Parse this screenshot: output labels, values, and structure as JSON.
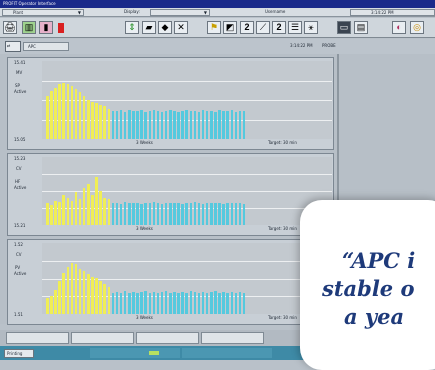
{
  "window": {
    "title": "PROFIT Operator Interface"
  },
  "menubar": {
    "plant_label": "Plant",
    "display_label": "Display:",
    "username_label": "Username",
    "time": "3:14:22 PM"
  },
  "subheader": {
    "section": "APC",
    "timestamp": "3:14:22 PM",
    "mode": "PROBE"
  },
  "panels": [
    {
      "top_value": "15.41",
      "var_type": "MV",
      "var_name": "SP",
      "status": "Active",
      "bottom_value": "15.05",
      "footer_mid": "3 Weeks",
      "footer_right": "Target: 30 min"
    },
    {
      "top_value": "15.23",
      "var_type": "CV",
      "var_name": "HF",
      "status": "Active",
      "bottom_value": "15.21",
      "footer_mid": "3 Weeks",
      "footer_right": "Target: 30 min"
    },
    {
      "top_value": "1.52",
      "var_type": "CV",
      "var_name": "PV",
      "status": "Active",
      "bottom_value": "1.51",
      "footer_mid": "3 Weeks",
      "footer_right": "Target: 30 min"
    }
  ],
  "chart_data": [
    {
      "type": "bar",
      "series": [
        {
          "color": "#f0ee55",
          "values": [
            0.55,
            0.62,
            0.66,
            0.7,
            0.72,
            0.7,
            0.68,
            0.64,
            0.6,
            0.55,
            0.5,
            0.48,
            0.46,
            0.44,
            0.42,
            0.38
          ]
        },
        {
          "color": "#55c9de",
          "values": [
            0.36,
            0.36,
            0.37,
            0.35,
            0.37,
            0.36,
            0.36,
            0.37,
            0.35,
            0.36,
            0.37,
            0.36,
            0.35,
            0.36,
            0.37,
            0.36,
            0.35,
            0.36,
            0.37,
            0.36,
            0.36,
            0.35,
            0.37,
            0.36,
            0.36,
            0.35,
            0.37,
            0.36,
            0.36,
            0.37,
            0.35,
            0.36,
            0.36
          ]
        }
      ]
    },
    {
      "type": "bar",
      "series": [
        {
          "color": "#f0ee55",
          "values": [
            0.32,
            0.3,
            0.36,
            0.34,
            0.44,
            0.4,
            0.36,
            0.48,
            0.38,
            0.54,
            0.6,
            0.44,
            0.7,
            0.5,
            0.4,
            0.38
          ]
        },
        {
          "color": "#55c9de",
          "values": [
            0.32,
            0.33,
            0.31,
            0.34,
            0.32,
            0.33,
            0.32,
            0.31,
            0.33,
            0.32,
            0.34,
            0.32,
            0.31,
            0.33,
            0.32,
            0.33,
            0.32,
            0.31,
            0.33,
            0.32,
            0.34,
            0.32,
            0.31,
            0.33,
            0.32,
            0.33,
            0.32,
            0.31,
            0.33,
            0.32,
            0.33,
            0.32,
            0.31
          ]
        }
      ]
    },
    {
      "type": "bar",
      "series": [
        {
          "color": "#f0ee55",
          "values": [
            0.22,
            0.26,
            0.34,
            0.46,
            0.58,
            0.66,
            0.72,
            0.7,
            0.64,
            0.6,
            0.56,
            0.52,
            0.5,
            0.46,
            0.42,
            0.38
          ]
        },
        {
          "color": "#55c9de",
          "values": [
            0.3,
            0.31,
            0.3,
            0.32,
            0.3,
            0.31,
            0.3,
            0.31,
            0.32,
            0.3,
            0.31,
            0.3,
            0.31,
            0.32,
            0.3,
            0.31,
            0.3,
            0.31,
            0.3,
            0.32,
            0.31,
            0.3,
            0.31,
            0.3,
            0.31,
            0.32,
            0.3,
            0.31,
            0.3,
            0.31,
            0.3,
            0.31,
            0.3
          ]
        }
      ]
    }
  ],
  "statusbar": {
    "left_tab": "Printing"
  },
  "quote": {
    "line1": "“APC i",
    "line2": "stable o",
    "line3": "a yea"
  }
}
